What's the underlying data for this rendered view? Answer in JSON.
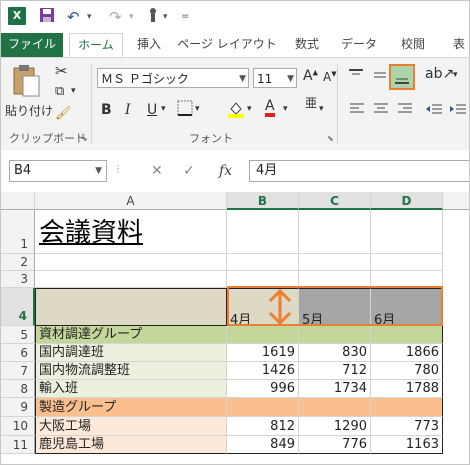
{
  "qat": {
    "app_icon_label": "X",
    "icons": [
      "excel-logo-icon",
      "save-icon",
      "undo-icon",
      "redo-icon",
      "touch-mode-icon",
      "customize-qat-icon"
    ]
  },
  "tabs": [
    {
      "label": "ファイル",
      "kind": "file"
    },
    {
      "label": "ホーム",
      "kind": "active"
    },
    {
      "label": "挿入",
      "kind": "normal"
    },
    {
      "label": "ページ レイアウト",
      "kind": "normal"
    },
    {
      "label": "数式",
      "kind": "normal"
    },
    {
      "label": "データ",
      "kind": "normal"
    },
    {
      "label": "校閲",
      "kind": "normal"
    },
    {
      "label": "表",
      "kind": "normal"
    }
  ],
  "ribbon": {
    "paste_label": "貼り付け",
    "clipboard_group": "クリップボード",
    "font_group": "フォント",
    "font_name": "ＭＳ Ｐゴシック",
    "font_size": "11",
    "bold": "B",
    "italic": "I",
    "underline": "U",
    "grow_font": "A",
    "shrink_font": "A"
  },
  "formula_bar": {
    "name_box": "B4",
    "formula": "4月",
    "fx": "fx"
  },
  "sheet": {
    "columns": [
      "A",
      "B",
      "C",
      "D"
    ],
    "selected_columns": [
      "B",
      "C",
      "D"
    ],
    "rows": [
      "1",
      "2",
      "3",
      "4",
      "5",
      "6",
      "7",
      "8",
      "9",
      "10",
      "11"
    ],
    "selected_row": "4",
    "title": "会議資料",
    "header_cells": [
      "4月",
      "5月",
      "6月"
    ],
    "data": [
      {
        "label": "資材調達グループ",
        "values": [
          "",
          "",
          ""
        ],
        "kind": "group-green"
      },
      {
        "label": "国内調達班",
        "values": [
          "1619",
          "830",
          "1866"
        ],
        "kind": "item-green"
      },
      {
        "label": "国内物流調整班",
        "values": [
          "1426",
          "712",
          "780"
        ],
        "kind": "item-green"
      },
      {
        "label": "輸入班",
        "values": [
          "996",
          "1734",
          "1788"
        ],
        "kind": "item-green"
      },
      {
        "label": "製造グループ",
        "values": [
          "",
          "",
          ""
        ],
        "kind": "group-orange"
      },
      {
        "label": "大阪工場",
        "values": [
          "812",
          "1290",
          "773"
        ],
        "kind": "item-orange"
      },
      {
        "label": "鹿児島工場",
        "values": [
          "849",
          "776",
          "1163"
        ],
        "kind": "item-orange"
      }
    ]
  },
  "colors": {
    "excel_green": "#217346",
    "highlight_orange": "#ed7d31",
    "header_fill_b": "#ddd9c4",
    "header_fill_cd": "#a6a6a6",
    "group_green": "#c4d79b",
    "item_green": "#ebf1de",
    "group_orange": "#fabf8f",
    "item_orange": "#fde9d9"
  }
}
